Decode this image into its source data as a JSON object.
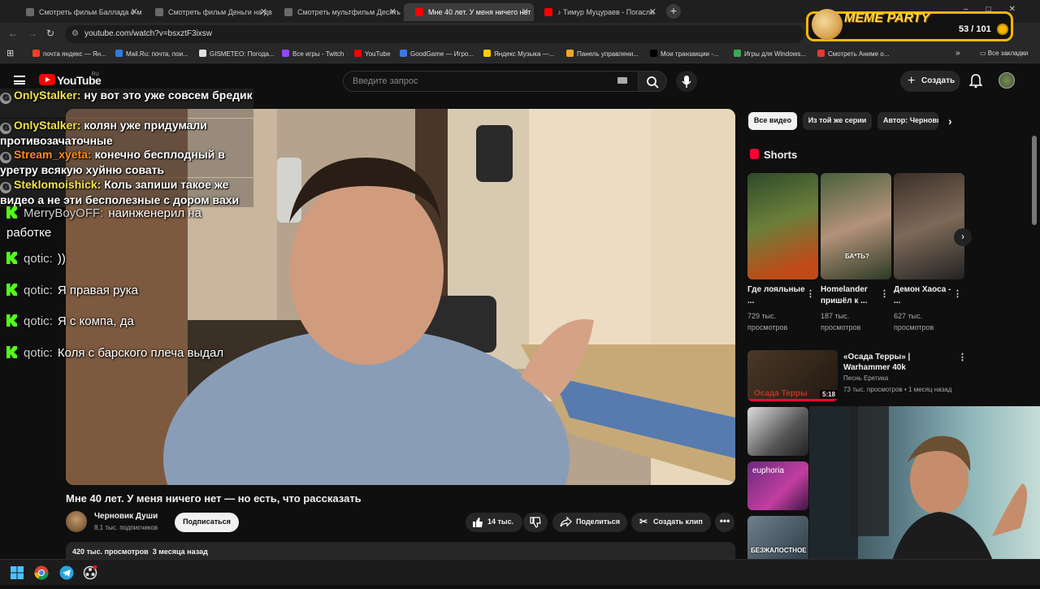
{
  "browser": {
    "tabs": [
      {
        "label": "Смотреть фильм Баллада о м",
        "color": "#6a6a6a"
      },
      {
        "label": "Смотреть фильм Деньги на дв",
        "color": "#6a6a6a"
      },
      {
        "label": "Смотреть мультфильм Десять",
        "color": "#6a6a6a"
      },
      {
        "label": "Мне 40 лет. У меня ничего нет",
        "color": "#ff0000"
      },
      {
        "label": "♪ Тимур Муцураев - Погасли",
        "color": "#ff0000"
      }
    ],
    "url": "youtube.com/watch?v=bsxztF3ixsw",
    "bookmarks": [
      {
        "label": "почта яндекс — Ян...",
        "color": "#fc3f1d"
      },
      {
        "label": "Mail.Ru: почта, пои...",
        "color": "#2a7de1"
      },
      {
        "label": "GISMETEO: Погода...",
        "color": "#e0e0e0"
      },
      {
        "label": "Все игры - Twitch",
        "color": "#9146ff"
      },
      {
        "label": "YouTube",
        "color": "#ff0000"
      },
      {
        "label": "GoodGame — Игро...",
        "color": "#3b78e7"
      },
      {
        "label": "Яндекс Музыка —...",
        "color": "#ffcc00"
      },
      {
        "label": "Панель управлени...",
        "color": "#f5a623"
      },
      {
        "label": "Мои транзакции -...",
        "color": "#000000"
      },
      {
        "label": "Игры для Windows...",
        "color": "#3aa757"
      },
      {
        "label": "Смотреть Аниме о...",
        "color": "#e53935"
      }
    ],
    "all_bookmarks": "Все закладки"
  },
  "meme_party": {
    "title": "MEME PARTY",
    "score": "53 / 101"
  },
  "youtube": {
    "brand": "YouTube",
    "region": "RU",
    "search_placeholder": "Введите запрос",
    "create_label": "Создать",
    "video": {
      "title": "Мне 40 лет. У меня ничего нет — но есть, что рассказать",
      "channel": "Черновик Души",
      "subscribers": "8,1 тыс. подписчиков",
      "subscribe_label": "Подписаться",
      "likes": "14 тыс.",
      "share_label": "Поделиться",
      "clip_label": "Создать клип",
      "views": "420 тыс. просмотров",
      "date": "3 месяца назад"
    },
    "chat_overlay": [
      {
        "user": "OnlyStalker:",
        "text": "ну вот это уже совсем бредик",
        "user_color": "#f3e34a"
      },
      {
        "user": "OnlyStalker:",
        "text": "колян уже придумали противозачаточные",
        "user_color": "#f3e34a"
      },
      {
        "user": "Stream_xyeta:",
        "text": "конечно бесплодный в уретру всякую хуйню совать",
        "user_color": "#ff8c1a"
      },
      {
        "user": "Steklomoishick:",
        "text": "Коль запиши такое же видео а не эти бесполезные с дором вахи",
        "user_color": "#f3e34a"
      }
    ],
    "kick_chat": [
      {
        "user": "MerryBoyOFF:",
        "text": "наинженерил на работке"
      },
      {
        "user": "qotic:",
        "text": "))"
      },
      {
        "user": "qotic:",
        "text": "Я правая рука"
      },
      {
        "user": "qotic:",
        "text": "Я с компа, да"
      },
      {
        "user": "qotic:",
        "text": "Коля с барского плеча выдал"
      }
    ],
    "chips": [
      "Все видео",
      "Из той же серии",
      "Автор: Черновик Души"
    ],
    "shorts_heading": "Shorts",
    "shorts": [
      {
        "title": "Где лояльные ...",
        "views": "729 тыс. просмотров"
      },
      {
        "title": "Homelander пришёл к ...",
        "views": "187 тыс. просмотров"
      },
      {
        "title": "Демон Хаоса - ...",
        "views": "627 тыс. просмотров"
      }
    ],
    "short_caption": "БА*ТЬ?",
    "recommended": {
      "title": "«Осада Терры» | Warhammer 40k",
      "channel": "Песнь Еретика",
      "meta": "73 тыс. просмотров • 1 месяц назад",
      "duration": "5:18",
      "thumb_caption": "Осада Терры"
    },
    "thumb_texts": [
      "euphoria",
      "БЕЗЖАЛОСТНОЕ"
    ]
  }
}
